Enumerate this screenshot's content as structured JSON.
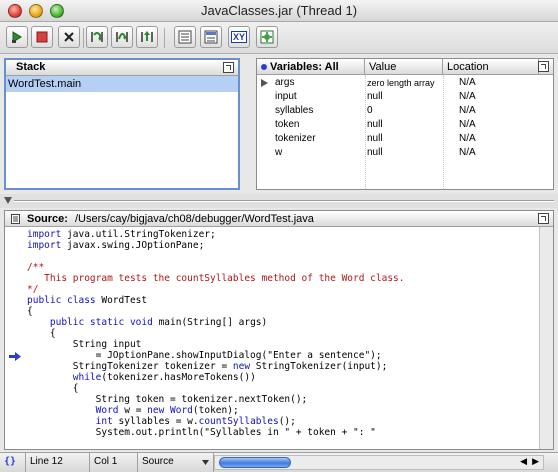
{
  "window": {
    "title": "JavaClasses.jar (Thread 1)"
  },
  "toolbar": {
    "buttons": [
      {
        "name": "run-icon"
      },
      {
        "name": "stop-icon"
      },
      {
        "name": "kill-icon"
      },
      {
        "name": "step-into-icon"
      },
      {
        "name": "step-over-icon"
      },
      {
        "name": "step-out-icon"
      },
      {
        "name": "list-view-icon"
      },
      {
        "name": "detail-view-icon"
      },
      {
        "name": "xy-icon"
      },
      {
        "name": "gear-icon"
      }
    ],
    "xy_label": "XY"
  },
  "stack": {
    "title": "Stack",
    "items": [
      "WordTest.main"
    ]
  },
  "variables": {
    "headers": {
      "name": "Variables: All",
      "value": "Value",
      "location": "Location"
    },
    "rows": [
      {
        "name": "args",
        "value": "zero length array",
        "location": "N/A",
        "expandable": true
      },
      {
        "name": "input",
        "value": "null",
        "location": "N/A"
      },
      {
        "name": "syllables",
        "value": "0",
        "location": "N/A"
      },
      {
        "name": "token",
        "value": "null",
        "location": "N/A"
      },
      {
        "name": "tokenizer",
        "value": "null",
        "location": "N/A"
      },
      {
        "name": "w",
        "value": "null",
        "location": "N/A"
      }
    ]
  },
  "source": {
    "label": "Source:",
    "path": "/Users/cay/bigjava/ch08/debugger/WordTest.java",
    "current_line_index": 11
  },
  "code_lines": [
    [
      [
        "kw",
        "import"
      ],
      [
        "",
        "java.util.StringTokenizer;"
      ]
    ],
    [
      [
        "kw",
        "import"
      ],
      [
        "",
        "javax.swing.JOptionPane;"
      ]
    ],
    [],
    [
      [
        "cm",
        "/**"
      ]
    ],
    [
      [
        "cm",
        "   This program tests the countSyllables method of the Word class."
      ]
    ],
    [
      [
        "cm",
        "*/"
      ]
    ],
    [
      [
        "kw",
        "public class"
      ],
      [
        "",
        "WordTest"
      ]
    ],
    [
      [
        "",
        "{"
      ]
    ],
    [
      [
        "",
        "    "
      ],
      [
        "kw",
        "public static void"
      ],
      [
        "",
        "main(String[] args)"
      ]
    ],
    [
      [
        "",
        "    {"
      ]
    ],
    [
      [
        "",
        "        String input"
      ]
    ],
    [
      [
        "",
        "            = JOptionPane.showInputDialog(\"Enter a sentence\");"
      ]
    ],
    [
      [
        "",
        "        StringTokenizer tokenizer = "
      ],
      [
        "kw",
        "new"
      ],
      [
        "",
        "StringTokenizer(input);"
      ]
    ],
    [
      [
        "",
        "        "
      ],
      [
        "kw",
        "while"
      ],
      [
        "",
        "(tokenizer.hasMoreTokens())"
      ]
    ],
    [
      [
        "",
        "        {"
      ]
    ],
    [
      [
        "",
        "            String token = tokenizer.nextToken();"
      ]
    ],
    [
      [
        "",
        "            "
      ],
      [
        "kw",
        "Word"
      ],
      [
        "",
        "w = "
      ],
      [
        "kw",
        "new Word"
      ],
      [
        "",
        "(token);"
      ]
    ],
    [
      [
        "",
        "            "
      ],
      [
        "kw",
        "int"
      ],
      [
        "",
        "syllables = w."
      ],
      [
        "kw",
        "countSyllables"
      ],
      [
        "",
        "();"
      ]
    ],
    [
      [
        "",
        "            System.out.println(\"Syllables in \" + token + \": \""
      ]
    ]
  ],
  "status": {
    "line": "Line 12",
    "col": "Col 1",
    "mode": "Source"
  },
  "colors": {
    "selection": "#b6d0f5",
    "keyword": "#1010c8",
    "comment": "#b01818",
    "arrow": "#2a40c8"
  }
}
